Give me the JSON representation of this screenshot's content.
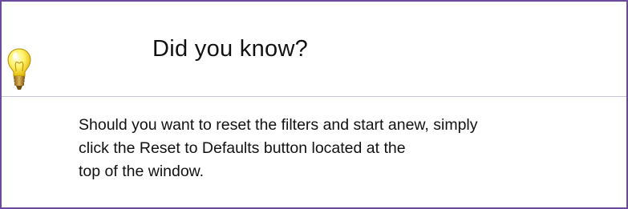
{
  "tip": {
    "title": "Did you know?",
    "icon": "lightbulb-icon",
    "lines": [
      "Should you want to reset the filters and start anew, simply",
      "click the  Reset to Defaults button located at the",
      "top of the window."
    ]
  },
  "colors": {
    "border": "#6b4a9b",
    "divider": "#c9c3d3",
    "bulb_glass": "#fff36a",
    "bulb_base": "#b98a2a"
  }
}
